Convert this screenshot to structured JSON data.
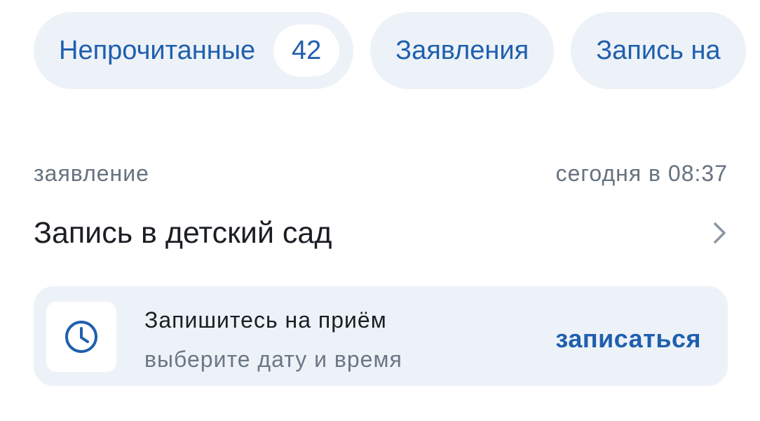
{
  "filters": {
    "unread_label": "Непрочитанные",
    "unread_count": "42",
    "applications_label": "Заявления",
    "appointment_label": "Запись на"
  },
  "item": {
    "category": "заявление",
    "time": "сегодня в 08:37",
    "title": "Запись в детский сад"
  },
  "action_card": {
    "icon": "clock-icon",
    "title": "Запишитесь на приём",
    "subtitle": "выберите дату и время",
    "action_label": "записаться"
  },
  "colors": {
    "accent": "#1f5fae",
    "chip_background": "#edf2f8",
    "text_primary": "#1b1f24",
    "text_secondary": "#66727f"
  }
}
